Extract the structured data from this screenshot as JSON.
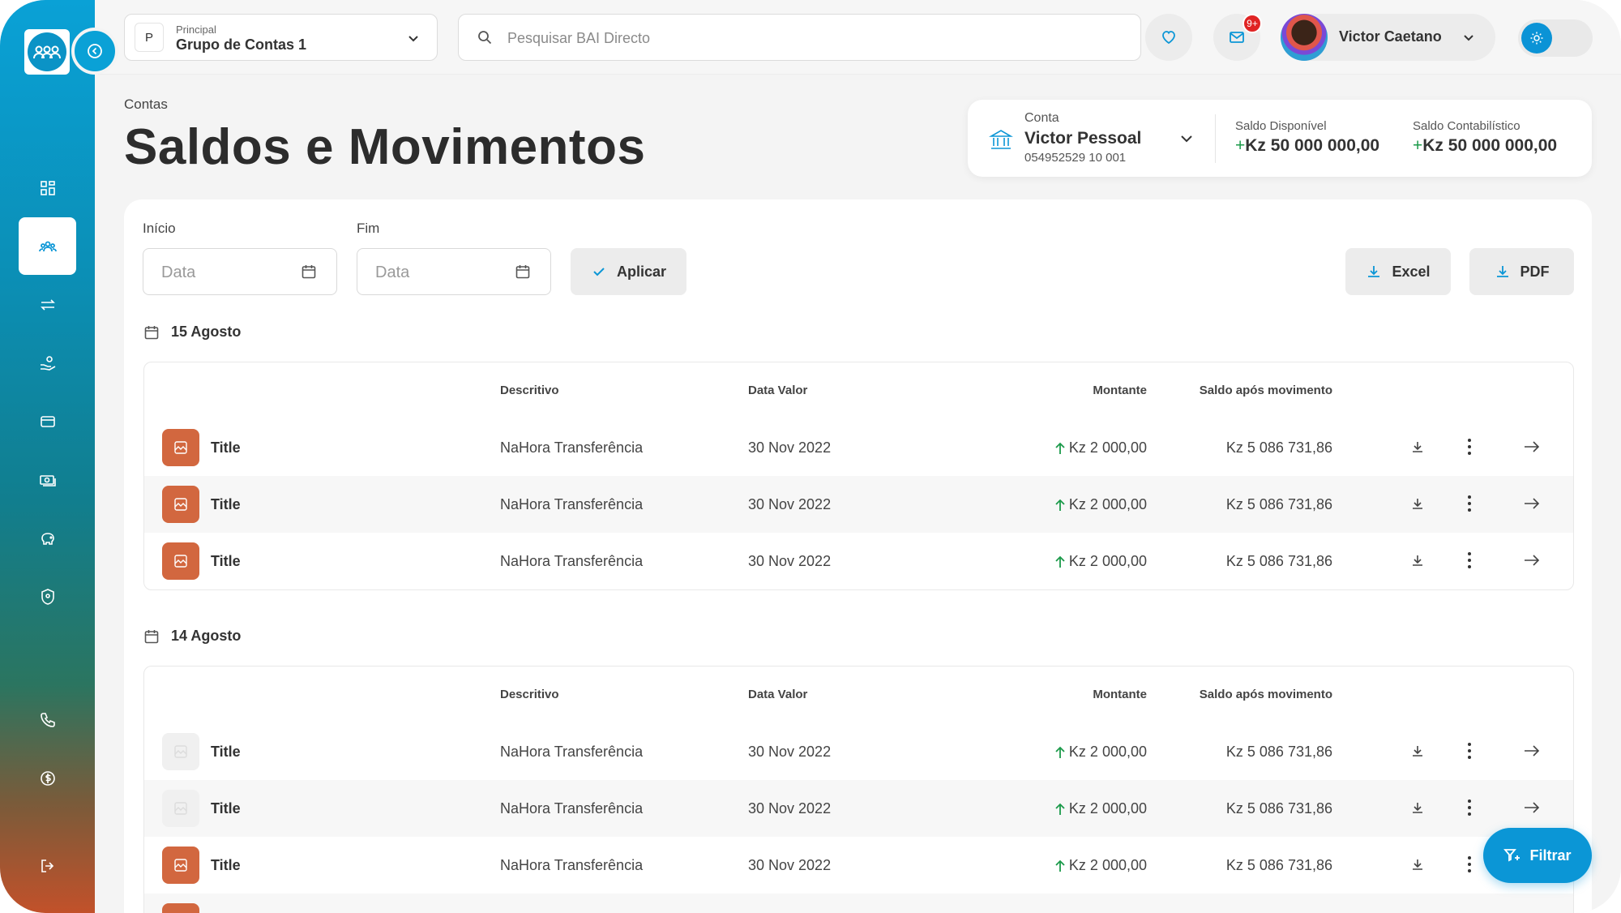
{
  "topbar": {
    "group_badge": "P",
    "group_small_label": "Principal",
    "group_name": "Grupo de Contas 1",
    "search_placeholder": "Pesquisar BAI Directo",
    "notif_count": "9+",
    "user_name": "Victor Caetano"
  },
  "header": {
    "breadcrumb": "Contas",
    "title": "Saldos e Movimentos"
  },
  "account": {
    "label": "Conta",
    "name": "Victor Pessoal",
    "number": "054952529 10 001",
    "available_label": "Saldo Disponível",
    "available_value": "Kz 50 000 000,00",
    "accounting_label": "Saldo Contabilístico",
    "accounting_value": "Kz 50 000 000,00",
    "plus_sign": "+"
  },
  "filters": {
    "start_label": "Início",
    "end_label": "Fim",
    "date_placeholder": "Data",
    "apply_label": "Aplicar",
    "excel_label": "Excel",
    "pdf_label": "PDF"
  },
  "columns": {
    "description": "Descritivo",
    "value_date": "Data Valor",
    "amount": "Montante",
    "balance_after": "Saldo após movimento"
  },
  "groups": [
    {
      "date": "15 Agosto",
      "rows": [
        {
          "title": "Title",
          "description": "NaHora Transferência",
          "value_date": "30 Nov 2022",
          "amount": "Kz 2 000,00",
          "balance": "Kz 5 086 731,86"
        },
        {
          "title": "Title",
          "description": "NaHora Transferência",
          "value_date": "30 Nov 2022",
          "amount": "Kz 2 000,00",
          "balance": "Kz 5 086 731,86"
        },
        {
          "title": "Title",
          "description": "NaHora Transferência",
          "value_date": "30 Nov 2022",
          "amount": "Kz 2 000,00",
          "balance": "Kz 5 086 731,86"
        }
      ]
    },
    {
      "date": "14 Agosto",
      "rows": [
        {
          "title": "Title",
          "description": "NaHora Transferência",
          "value_date": "30 Nov 2022",
          "amount": "Kz 2 000,00",
          "balance": "Kz 5 086 731,86"
        },
        {
          "title": "Title",
          "description": "NaHora Transferência",
          "value_date": "30 Nov 2022",
          "amount": "Kz 2 000,00",
          "balance": "Kz 5 086 731,86"
        },
        {
          "title": "Title",
          "description": "NaHora Transferência",
          "value_date": "30 Nov 2022",
          "amount": "Kz 2 000,00",
          "balance": "Kz 5 086 731,86"
        }
      ]
    }
  ],
  "fab": {
    "label": "Filtrar"
  },
  "colors": {
    "accent": "#0b96d6",
    "thumb": "#d2673f",
    "positive": "#1b9a4a"
  }
}
